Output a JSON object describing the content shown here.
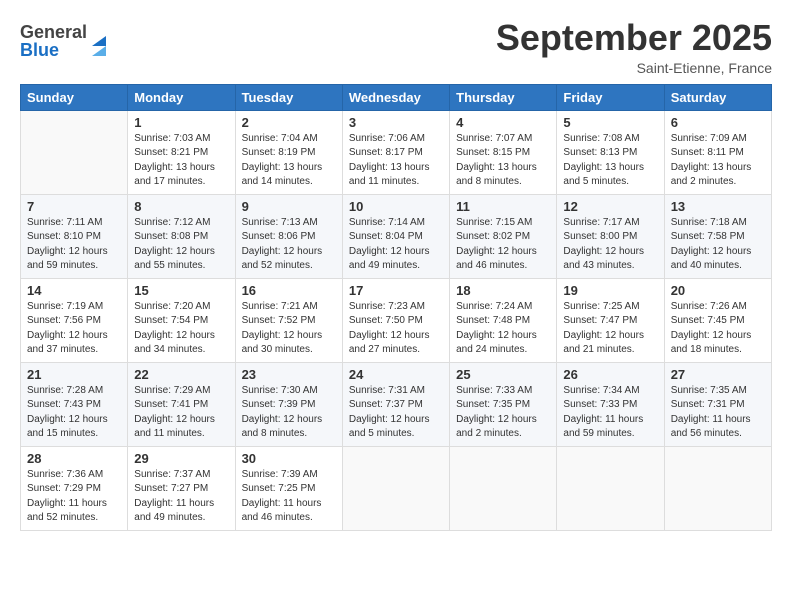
{
  "header": {
    "logo_general": "General",
    "logo_blue": "Blue",
    "month_title": "September 2025",
    "location": "Saint-Etienne, France"
  },
  "days_of_week": [
    "Sunday",
    "Monday",
    "Tuesday",
    "Wednesday",
    "Thursday",
    "Friday",
    "Saturday"
  ],
  "weeks": [
    [
      {
        "day": "",
        "info": ""
      },
      {
        "day": "1",
        "info": "Sunrise: 7:03 AM\nSunset: 8:21 PM\nDaylight: 13 hours\nand 17 minutes."
      },
      {
        "day": "2",
        "info": "Sunrise: 7:04 AM\nSunset: 8:19 PM\nDaylight: 13 hours\nand 14 minutes."
      },
      {
        "day": "3",
        "info": "Sunrise: 7:06 AM\nSunset: 8:17 PM\nDaylight: 13 hours\nand 11 minutes."
      },
      {
        "day": "4",
        "info": "Sunrise: 7:07 AM\nSunset: 8:15 PM\nDaylight: 13 hours\nand 8 minutes."
      },
      {
        "day": "5",
        "info": "Sunrise: 7:08 AM\nSunset: 8:13 PM\nDaylight: 13 hours\nand 5 minutes."
      },
      {
        "day": "6",
        "info": "Sunrise: 7:09 AM\nSunset: 8:11 PM\nDaylight: 13 hours\nand 2 minutes."
      }
    ],
    [
      {
        "day": "7",
        "info": "Sunrise: 7:11 AM\nSunset: 8:10 PM\nDaylight: 12 hours\nand 59 minutes."
      },
      {
        "day": "8",
        "info": "Sunrise: 7:12 AM\nSunset: 8:08 PM\nDaylight: 12 hours\nand 55 minutes."
      },
      {
        "day": "9",
        "info": "Sunrise: 7:13 AM\nSunset: 8:06 PM\nDaylight: 12 hours\nand 52 minutes."
      },
      {
        "day": "10",
        "info": "Sunrise: 7:14 AM\nSunset: 8:04 PM\nDaylight: 12 hours\nand 49 minutes."
      },
      {
        "day": "11",
        "info": "Sunrise: 7:15 AM\nSunset: 8:02 PM\nDaylight: 12 hours\nand 46 minutes."
      },
      {
        "day": "12",
        "info": "Sunrise: 7:17 AM\nSunset: 8:00 PM\nDaylight: 12 hours\nand 43 minutes."
      },
      {
        "day": "13",
        "info": "Sunrise: 7:18 AM\nSunset: 7:58 PM\nDaylight: 12 hours\nand 40 minutes."
      }
    ],
    [
      {
        "day": "14",
        "info": "Sunrise: 7:19 AM\nSunset: 7:56 PM\nDaylight: 12 hours\nand 37 minutes."
      },
      {
        "day": "15",
        "info": "Sunrise: 7:20 AM\nSunset: 7:54 PM\nDaylight: 12 hours\nand 34 minutes."
      },
      {
        "day": "16",
        "info": "Sunrise: 7:21 AM\nSunset: 7:52 PM\nDaylight: 12 hours\nand 30 minutes."
      },
      {
        "day": "17",
        "info": "Sunrise: 7:23 AM\nSunset: 7:50 PM\nDaylight: 12 hours\nand 27 minutes."
      },
      {
        "day": "18",
        "info": "Sunrise: 7:24 AM\nSunset: 7:48 PM\nDaylight: 12 hours\nand 24 minutes."
      },
      {
        "day": "19",
        "info": "Sunrise: 7:25 AM\nSunset: 7:47 PM\nDaylight: 12 hours\nand 21 minutes."
      },
      {
        "day": "20",
        "info": "Sunrise: 7:26 AM\nSunset: 7:45 PM\nDaylight: 12 hours\nand 18 minutes."
      }
    ],
    [
      {
        "day": "21",
        "info": "Sunrise: 7:28 AM\nSunset: 7:43 PM\nDaylight: 12 hours\nand 15 minutes."
      },
      {
        "day": "22",
        "info": "Sunrise: 7:29 AM\nSunset: 7:41 PM\nDaylight: 12 hours\nand 11 minutes."
      },
      {
        "day": "23",
        "info": "Sunrise: 7:30 AM\nSunset: 7:39 PM\nDaylight: 12 hours\nand 8 minutes."
      },
      {
        "day": "24",
        "info": "Sunrise: 7:31 AM\nSunset: 7:37 PM\nDaylight: 12 hours\nand 5 minutes."
      },
      {
        "day": "25",
        "info": "Sunrise: 7:33 AM\nSunset: 7:35 PM\nDaylight: 12 hours\nand 2 minutes."
      },
      {
        "day": "26",
        "info": "Sunrise: 7:34 AM\nSunset: 7:33 PM\nDaylight: 11 hours\nand 59 minutes."
      },
      {
        "day": "27",
        "info": "Sunrise: 7:35 AM\nSunset: 7:31 PM\nDaylight: 11 hours\nand 56 minutes."
      }
    ],
    [
      {
        "day": "28",
        "info": "Sunrise: 7:36 AM\nSunset: 7:29 PM\nDaylight: 11 hours\nand 52 minutes."
      },
      {
        "day": "29",
        "info": "Sunrise: 7:37 AM\nSunset: 7:27 PM\nDaylight: 11 hours\nand 49 minutes."
      },
      {
        "day": "30",
        "info": "Sunrise: 7:39 AM\nSunset: 7:25 PM\nDaylight: 11 hours\nand 46 minutes."
      },
      {
        "day": "",
        "info": ""
      },
      {
        "day": "",
        "info": ""
      },
      {
        "day": "",
        "info": ""
      },
      {
        "day": "",
        "info": ""
      }
    ]
  ]
}
